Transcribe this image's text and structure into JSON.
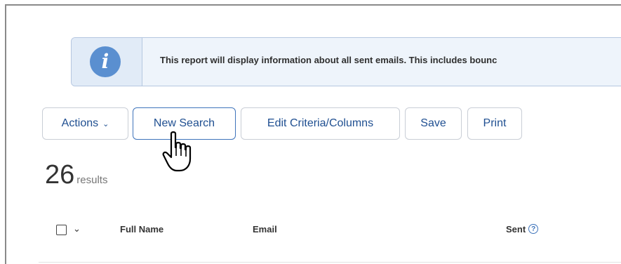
{
  "banner": {
    "icon": "info-icon",
    "icon_glyph": "i",
    "text": "This report will display information about all sent emails. This includes bounc"
  },
  "toolbar": {
    "actions_label": "Actions",
    "new_search_label": "New Search",
    "edit_criteria_label": "Edit Criteria/Columns",
    "save_label": "Save",
    "print_label": "Print"
  },
  "results": {
    "count": "26",
    "label": "results"
  },
  "table": {
    "columns": [
      "Full Name",
      "Email",
      "Sent"
    ],
    "help_glyph": "?"
  },
  "colors": {
    "accent": "#3f74bb",
    "banner_bg": "#eef4fb",
    "info_icon": "#5a8fd0"
  }
}
